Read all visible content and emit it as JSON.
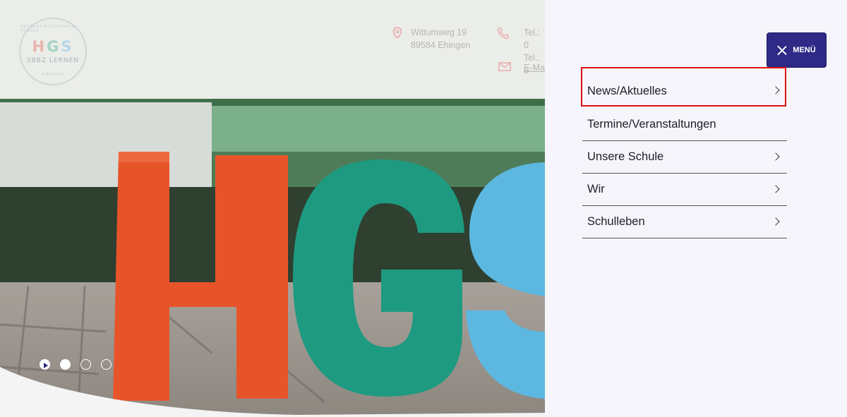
{
  "header": {
    "logo": {
      "main": [
        "H",
        "G",
        "S"
      ],
      "sub": "SBBZ LERNEN",
      "ring_top": "HERBERT-GOTTSCHALK-SCHULE",
      "ring_bottom": "EHINGEN"
    },
    "address": {
      "line1": "Wittumweg 19",
      "line2": "89584 Ehingen"
    },
    "phone": {
      "line1": "Tel.: 0",
      "line2": "Tel.: 0"
    },
    "mail": {
      "label": "E-Ma"
    }
  },
  "slider": {
    "dots": 3,
    "active_index": 0
  },
  "menu_button": {
    "label": "MENÜ"
  },
  "menu": {
    "items": [
      {
        "label": "News/Aktuelles",
        "has_submenu": true
      },
      {
        "label": "Termine/Veranstaltungen",
        "has_submenu": false
      },
      {
        "label": "Unsere Schule",
        "has_submenu": true
      },
      {
        "label": "Wir",
        "has_submenu": true
      },
      {
        "label": "Schulleben",
        "has_submenu": true
      }
    ]
  },
  "colors": {
    "menu_button_bg": "#2e2a86",
    "panel_bg": "#f6f5fb",
    "highlight": "#e01010",
    "letter_h": "#e8542a",
    "letter_g": "#1e9a80",
    "letter_s": "#5cb8e0"
  }
}
